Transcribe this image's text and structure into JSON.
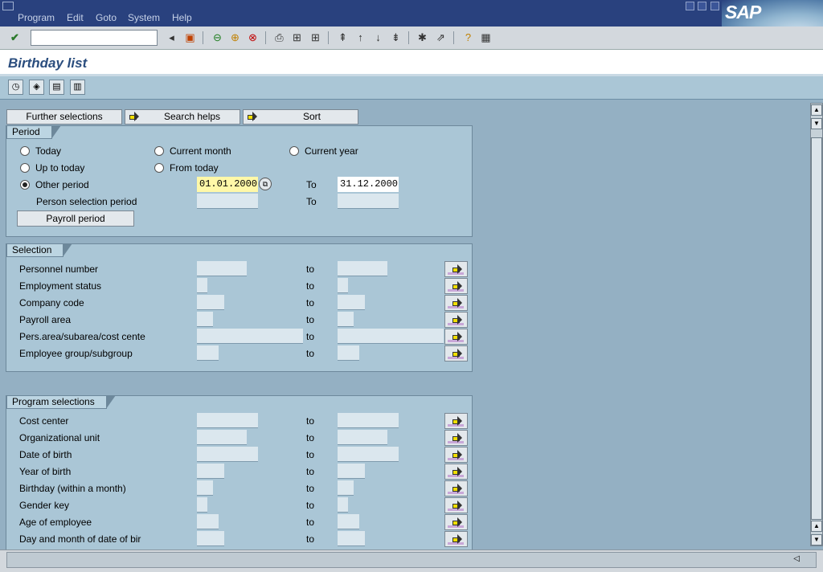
{
  "menu": {
    "program": "Program",
    "edit": "Edit",
    "goto": "Goto",
    "system": "System",
    "help": "Help"
  },
  "logo": "SAP",
  "page_title": "Birthday list",
  "tabs": {
    "further": "Further selections",
    "search": "Search helps",
    "sort": "Sort"
  },
  "period": {
    "title": "Period",
    "today": "Today",
    "current_month": "Current month",
    "current_year": "Current year",
    "up_to_today": "Up to today",
    "from_today": "From today",
    "other_period": "Other period",
    "from_value": "01.01.2000",
    "to_label": "To",
    "to_value": "31.12.2000",
    "person_sel": "Person selection period",
    "to_label2": "To",
    "payroll_btn": "Payroll period",
    "selected": "Other period"
  },
  "selection": {
    "title": "Selection",
    "to": "to",
    "rows": [
      "Personnel number",
      "Employment status",
      "Company code",
      "Payroll area",
      "Pers.area/subarea/cost cente",
      "Employee group/subgroup"
    ]
  },
  "program_sel": {
    "title": "Program selections",
    "to": "to",
    "rows": [
      "Cost center",
      "Organizational unit",
      "Date of birth",
      "Year of birth",
      "Birthday (within a month)",
      "Gender key",
      "Age of employee",
      "Day and month of date of bir"
    ]
  },
  "icons": [
    "check-icon",
    "back-icon",
    "save-icon",
    "green-back-icon",
    "exit-icon",
    "cancel-icon",
    "print-icon",
    "find-icon",
    "find-next-icon",
    "first-page-icon",
    "prev-page-icon",
    "next-page-icon",
    "last-page-icon",
    "create-session-icon",
    "shortcut-icon",
    "help-icon",
    "layout-icon",
    "execute-icon",
    "get-variant-icon",
    "save-variant-icon",
    "selection-options-icon",
    "multiple-selection-icon"
  ]
}
